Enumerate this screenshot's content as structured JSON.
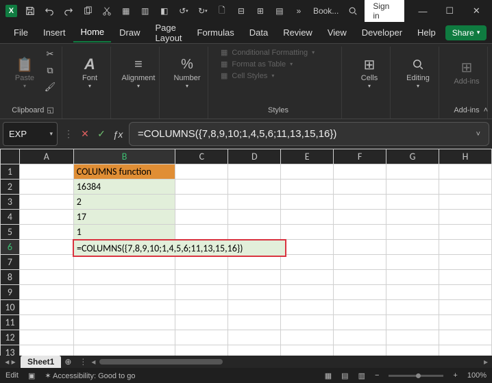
{
  "titlebar": {
    "app_letter": "X",
    "doc_title": "Book...",
    "signin": "Sign in"
  },
  "menu": {
    "tabs": [
      "File",
      "Insert",
      "Home",
      "Draw",
      "Page Layout",
      "Formulas",
      "Data",
      "Review",
      "View",
      "Developer",
      "Help"
    ],
    "active_index": 2,
    "share": "Share"
  },
  "ribbon": {
    "clipboard": {
      "label": "Clipboard",
      "paste": "Paste"
    },
    "font": {
      "label": "Font",
      "btn": "Font"
    },
    "alignment": {
      "label": "",
      "btn": "Alignment"
    },
    "number": {
      "label": "",
      "btn": "Number"
    },
    "styles": {
      "label": "Styles",
      "items": [
        "Conditional Formatting",
        "Format as Table",
        "Cell Styles"
      ]
    },
    "cells": {
      "btn": "Cells"
    },
    "editing": {
      "btn": "Editing"
    },
    "addins": {
      "label": "Add-ins",
      "btn": "Add-ins"
    }
  },
  "formula_row": {
    "namebox": "EXP",
    "formula": "=COLUMNS({7,8,9,10;1,4,5,6;11,13,15,16})"
  },
  "grid": {
    "col_headers": [
      "A",
      "B",
      "C",
      "D",
      "E",
      "F",
      "G",
      "H"
    ],
    "row_headers": [
      "1",
      "2",
      "3",
      "4",
      "5",
      "6",
      "7",
      "8",
      "9",
      "10",
      "11",
      "12",
      "13"
    ],
    "b1": "COLUMNS function",
    "b2": "16384",
    "b3": "2",
    "b4": "17",
    "b5": "1",
    "b6_edit": "=COLUMNS({7,8,9,10;1,4,5,6;11,13,15,16})"
  },
  "sheets": {
    "tab1": "Sheet1"
  },
  "statusbar": {
    "mode": "Edit",
    "accessibility": "Accessibility: Good to go",
    "zoom": "100%"
  }
}
